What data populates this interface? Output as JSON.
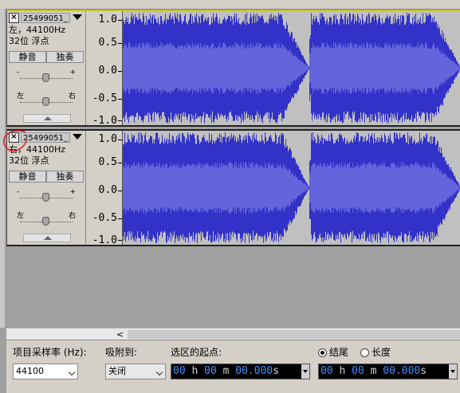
{
  "tracks": [
    {
      "name": "25499051_",
      "channel_rate": "左，44100Hz",
      "format": "32位 浮点",
      "mute_label": "静音",
      "solo_label": "独奏",
      "gain_min": "-",
      "gain_max": "+",
      "pan_left": "左",
      "pan_right": "右",
      "close_glyph": "×",
      "selected": true
    },
    {
      "name": "25499051_",
      "channel_rate": "右，44100Hz",
      "format": "32位 浮点",
      "mute_label": "静音",
      "solo_label": "独奏",
      "gain_min": "-",
      "gain_max": "+",
      "pan_left": "左",
      "pan_right": "右",
      "close_glyph": "×",
      "selected": false
    }
  ],
  "amplitude_ruler": [
    "1.0",
    "0.5",
    "0.0",
    "-0.5",
    "-1.0"
  ],
  "colors": {
    "waveform_peak": "#3232c8",
    "waveform_rms": "#6464dc",
    "track_background": "#c0c0c0",
    "selected_track_border": "#c8c030"
  },
  "scrollbar": {
    "left_arrow": "<"
  },
  "selection_toolbar": {
    "project_rate_label": "项目采样率 (Hz):",
    "project_rate_value": "44100",
    "snap_to_label": "吸附到:",
    "snap_to_value": "关闭",
    "selection_start_label": "选区的起点:",
    "end_option_label": "结尾",
    "length_option_label": "长度",
    "selected_option": "end",
    "start_time": {
      "hh": "00",
      "h_unit": "h",
      "mm": "00",
      "m_unit": "m",
      "ss": "00.000",
      "s_unit": "s"
    },
    "end_time": {
      "hh": "00",
      "h_unit": "h",
      "mm": "00",
      "m_unit": "m",
      "ss": "00.000",
      "s_unit": "s"
    }
  }
}
